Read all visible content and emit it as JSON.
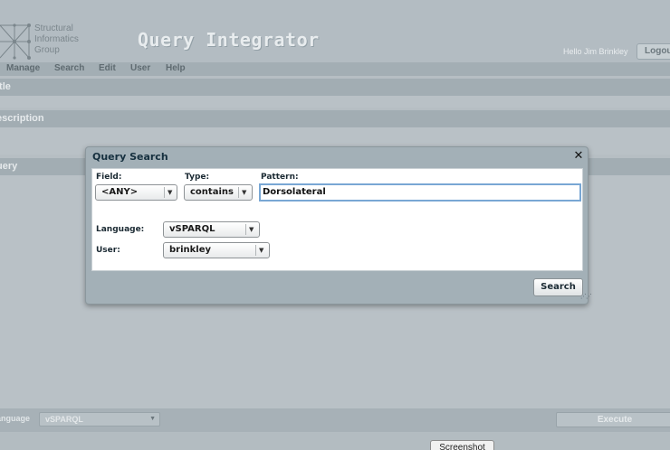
{
  "header": {
    "logo_lines": [
      "Structural",
      "Informatics",
      "Group"
    ],
    "app_title": "Query Integrator",
    "greeting": "Hello Jim Brinkley",
    "logout_label": "Logou"
  },
  "menu": {
    "items": [
      {
        "label": "Manage"
      },
      {
        "label": "Search"
      },
      {
        "label": "Edit"
      },
      {
        "label": "User"
      },
      {
        "label": "Help"
      }
    ]
  },
  "sections": {
    "title_label": "itle",
    "description_label": "escription",
    "query_label": "uery"
  },
  "bottom": {
    "language_label": "anguage",
    "language_value": "vSPARQL",
    "execute_label": "Execute"
  },
  "footer": {
    "screenshot_label": "Screenshot"
  },
  "dialog": {
    "title": "Query Search",
    "close_symbol": "✕",
    "field_label": "Field:",
    "field_value": "<ANY>",
    "type_label": "Type:",
    "type_value": "contains",
    "pattern_label": "Pattern:",
    "pattern_value": "Dorsolateral",
    "language_label": "Language:",
    "language_value": "vSPARQL",
    "user_label": "User:",
    "user_value": "brinkley",
    "search_label": "Search"
  }
}
